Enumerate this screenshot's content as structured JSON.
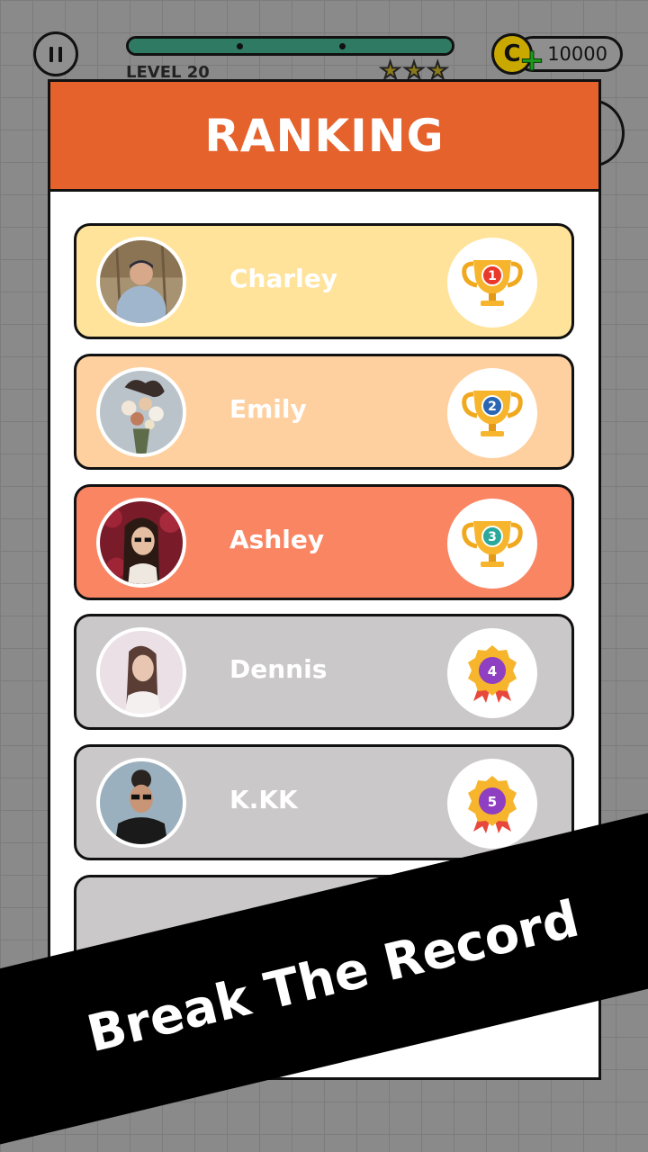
{
  "hud": {
    "level_label": "LEVEL 20",
    "progress_fraction": 1.0,
    "stars_count": 3,
    "coin_symbol": "C",
    "coin_plus": "+",
    "coins": "10000",
    "pause_icon": "pause-icon",
    "coin_icon": "coin-icon"
  },
  "modal": {
    "title": "RANKING"
  },
  "ranking": [
    {
      "rank": "1",
      "name": "Charley",
      "color": "#ffe39a",
      "trophy": "gold-trophy-icon",
      "badge_color": "#e8392b"
    },
    {
      "rank": "2",
      "name": "Emily",
      "color": "#ffd09f",
      "trophy": "gold-trophy-icon",
      "badge_color": "#2a66b3"
    },
    {
      "rank": "3",
      "name": "Ashley",
      "color": "#fa8563",
      "trophy": "gold-trophy-icon",
      "badge_color": "#2aa89a"
    },
    {
      "rank": "4",
      "name": "Dennis",
      "color": "#cac8c9",
      "trophy": "medal-icon",
      "badge_color": "#8f3fc2"
    },
    {
      "rank": "5",
      "name": "K.KK",
      "color": "#cac8c9",
      "trophy": "medal-icon",
      "badge_color": "#8f3fc2"
    }
  ],
  "banner": {
    "text": "Break The Record"
  },
  "colors": {
    "header": "#e5622c",
    "progress": "#2f7a62",
    "coin": "#c9a800"
  }
}
